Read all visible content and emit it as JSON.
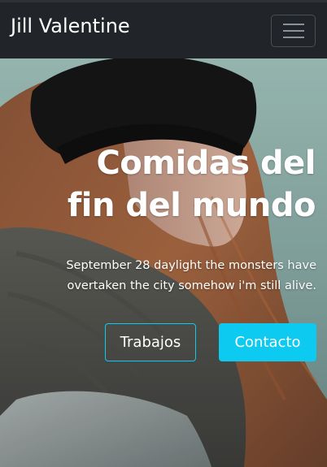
{
  "navbar": {
    "brand": "Jill Valentine",
    "toggler_icon": "hamburger-menu-icon"
  },
  "hero": {
    "headline": "Comidas del fin del mundo",
    "subtext": "September 28 daylight the monsters have overtaken the city somehow i'm still alive.",
    "buttons": {
      "work_label": "Trabajos",
      "contact_label": "Contacto"
    }
  },
  "colors": {
    "navbar_bg": "#212529",
    "accent": "#0dcaf0",
    "text": "#ffffff"
  }
}
